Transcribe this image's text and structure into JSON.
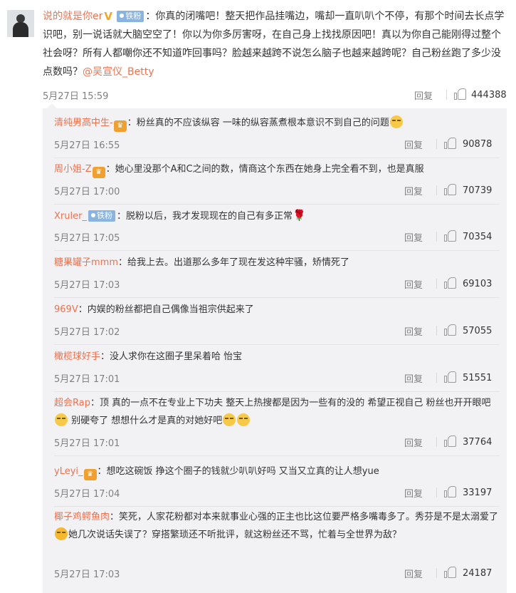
{
  "main_comment": {
    "username": "说的就是你er",
    "fan_badge": "铁粉",
    "text": "：你真的闭嘴吧！整天把作品挂嘴边，嘴却一直叭叭个不停，有那个时间去长点学识吧，别一说话就大脑空空了！你以为你多厉害呀，在自己身上找找原因吧！真以为你自己能刚得过整个社会呀？所有人都嘲你还不知道咋回事吗？脸越来越跨不说怎么脑子也越来越跨呢？自己粉丝跑了多少没点数吗？",
    "mention": "@吴宣仪_Betty",
    "time": "5月27日 15:59",
    "reply_label": "回复",
    "likes": "444388"
  },
  "replies": [
    {
      "username": "清纯男高中生-",
      "badge": "",
      "text": "：粉丝真的不应该纵容 一味的纵容蒸煮根本意识不到自己的问题",
      "time": "5月27日 16:55",
      "reply_label": "回复",
      "likes": "90878"
    },
    {
      "username": "周小姐-Z",
      "badge": "",
      "text": "：她心里没那个A和C之间的数，情商这个东西在她身上完全看不到，也是真服",
      "time": "5月27日 17:00",
      "reply_label": "回复",
      "likes": "70739"
    },
    {
      "username": "Xruler_",
      "badge": "铁粉",
      "text": "：脱粉以后，我才发现现在的自己有多正常",
      "time": "5月27日 17:05",
      "reply_label": "回复",
      "likes": "70354"
    },
    {
      "username": "糖果罐子mmm",
      "badge": "",
      "text": "：给我上去。出道那么多年了现在发这种牢骚，矫情死了",
      "time": "5月27日 17:03",
      "reply_label": "回复",
      "likes": "69103"
    },
    {
      "username": "969V",
      "badge": "",
      "text": "：内娱的粉丝都把自己偶像当祖宗供起来了",
      "time": "5月27日 17:02",
      "reply_label": "回复",
      "likes": "57055"
    },
    {
      "username": "橄榄球好手",
      "badge": "",
      "text": "：没人求你在这圈子里呆着哈 怡宝",
      "time": "5月27日 17:01",
      "reply_label": "回复",
      "likes": "51551"
    },
    {
      "username": "超会Rap",
      "badge": "",
      "text": "：顶 真的一点不在专业上下功夫 整天上热搜都是因为一些有的没的 希望正视自己 粉丝也开开眼吧",
      "text2": " 别硬夸了 想想什么才是真的对她好吧",
      "time": "5月27日 17:01",
      "reply_label": "回复",
      "likes": "37764"
    },
    {
      "username": "yLeyi_",
      "badge": "",
      "text": "：想吃这碗饭 挣这个圈子的钱就少叭叭好吗 又当又立真的让人想yue",
      "time": "5月27日 17:04",
      "reply_label": "回复",
      "likes": "33197"
    },
    {
      "username": "椰子鸡鳄鱼肉",
      "badge": "",
      "text": "：笑死，人家花粉都对本来就事业心强的正主也比这位要严格多嘴毒多了。秀芬是不是太溺爱了",
      "text2": "她几次说话失误了？穿搭繁琐还不听批评，就这粉丝还不骂，忙着与全世界为敌？",
      "time": "5月27日 17:03",
      "reply_label": "回复",
      "likes": "24187"
    }
  ],
  "icons": {
    "thumb": "thumbs-up-icon",
    "verified": "verified-v-icon",
    "emoji": "emoji-icon",
    "rose": "rose-icon"
  },
  "colors": {
    "username": "#eb7350",
    "background_sub": "#f2f2f5",
    "muted": "#808080"
  }
}
